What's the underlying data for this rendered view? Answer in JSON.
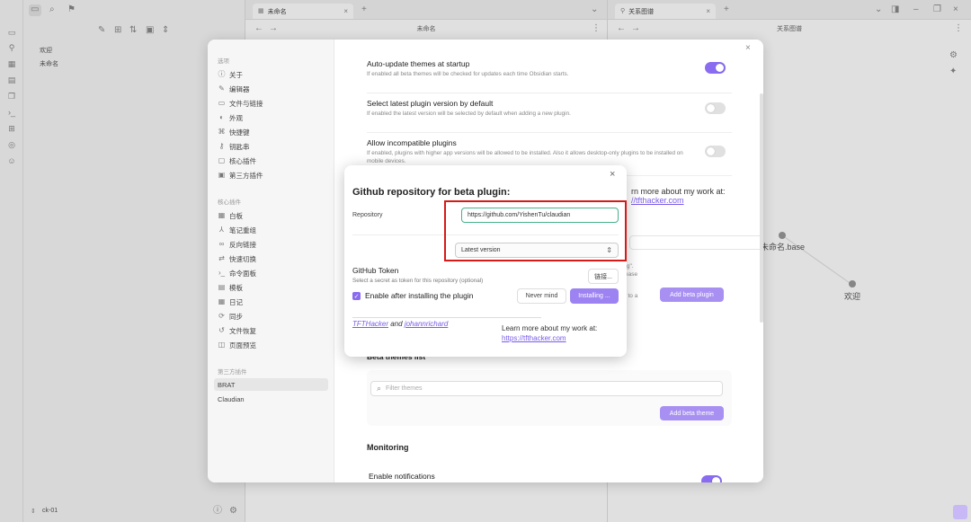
{
  "left_pane": {
    "files": [
      "欢迎",
      "未命名"
    ],
    "vault_name": "ck-01"
  },
  "middle_pane": {
    "tab_title": "未命名",
    "header": "未命名"
  },
  "right_pane": {
    "tab_title": "关系图谱",
    "header": "关系图谱",
    "graph_nodes": [
      "未命名.base",
      "欢迎"
    ],
    "bg_text": {
      "learn_more": "rn more about my work at:",
      "link": "//tfthacker.com",
      "frag1": "ting\".",
      "frag2": "elease",
      "frag3": "ext to a"
    }
  },
  "settings": {
    "group_options": "选项",
    "options": [
      "关于",
      "编辑器",
      "文件与链接",
      "外观",
      "快捷键",
      "钥匙串",
      "核心插件",
      "第三方插件"
    ],
    "group_core": "核心插件",
    "core_plugins": [
      "白板",
      "笔记重组",
      "反向链接",
      "快速切换",
      "命令面板",
      "模板",
      "日记",
      "同步",
      "文件恢复",
      "页面预览"
    ],
    "group_community": "第三方插件",
    "community_plugins": [
      "BRAT",
      "Claudian"
    ],
    "rows": [
      {
        "title": "Auto-update themes at startup",
        "desc": "If enabled all beta themes will be checked for updates each time Obsidian starts.",
        "on": true
      },
      {
        "title": "Select latest plugin version by default",
        "desc": "If enabled the latest version will be selected by default when adding a new plugin.",
        "on": false
      },
      {
        "title": "Allow incompatible plugins",
        "desc": "If enabled, plugins with higher app versions will be allowed to be installed. Also it allows desktop-only plugins to be installed on mobile devices.",
        "on": false
      }
    ],
    "add_beta_plugin": "Add beta plugin",
    "beta_themes_heading": "Beta themes list",
    "filter_placeholder": "Filter themes",
    "add_beta_theme": "Add beta theme",
    "monitoring_heading": "Monitoring",
    "enable_notifications": "Enable notifications"
  },
  "dialog": {
    "title": "Github repository for beta plugin:",
    "repo_label": "Repository",
    "repo_value": "https://github.com/YishenTu/claudian",
    "version_value": "Latest version",
    "token_title": "GitHub Token",
    "token_desc": "Select a secret as token for this repository (optional)",
    "link_button": "链接...",
    "enable_after_install": "Enable after installing the plugin",
    "never_mind": "Never mind",
    "installing": "Installing ...",
    "credit_author1": "TFTHacker",
    "credit_and": "and",
    "credit_author2": "johannrichard",
    "learn_more": "Learn more about my work at:",
    "learn_more_link": "https://tfthacker.com"
  },
  "colors": {
    "accent": "#8a6cf0",
    "highlight_box": "#d61a1a"
  }
}
